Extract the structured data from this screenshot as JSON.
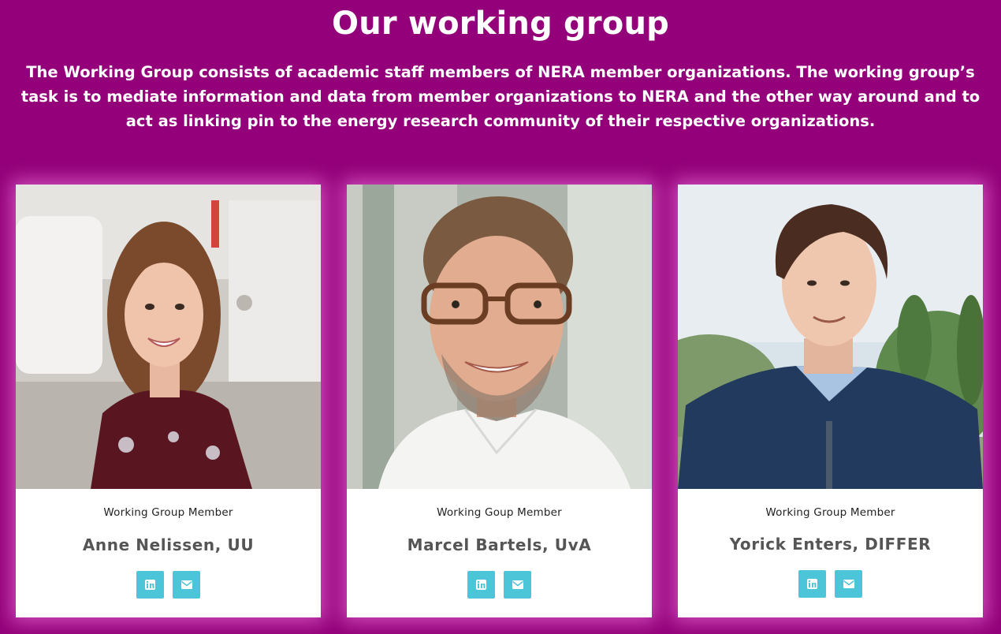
{
  "section": {
    "title": "Our working group",
    "intro": "The Working Group consists of academic staff members of NERA member organizations. The working group’s task is to mediate information and data from member organizations to NERA and the other way around and to act as linking pin to the energy research community of their respective organizations."
  },
  "members": [
    {
      "role": "Working Group Member",
      "name": "Anne Nelissen, UU"
    },
    {
      "role": "Working Goup Member",
      "name": "Marcel Bartels, UvA"
    },
    {
      "role": "Working Group Member",
      "name": "Yorick Enters, DIFFER"
    }
  ],
  "icons": {
    "linkedin": "linkedin-icon",
    "email": "envelope-icon"
  },
  "colors": {
    "background": "#930079",
    "card": "#ffffff",
    "social_button": "#4dc5d9",
    "name_text": "#555555"
  }
}
